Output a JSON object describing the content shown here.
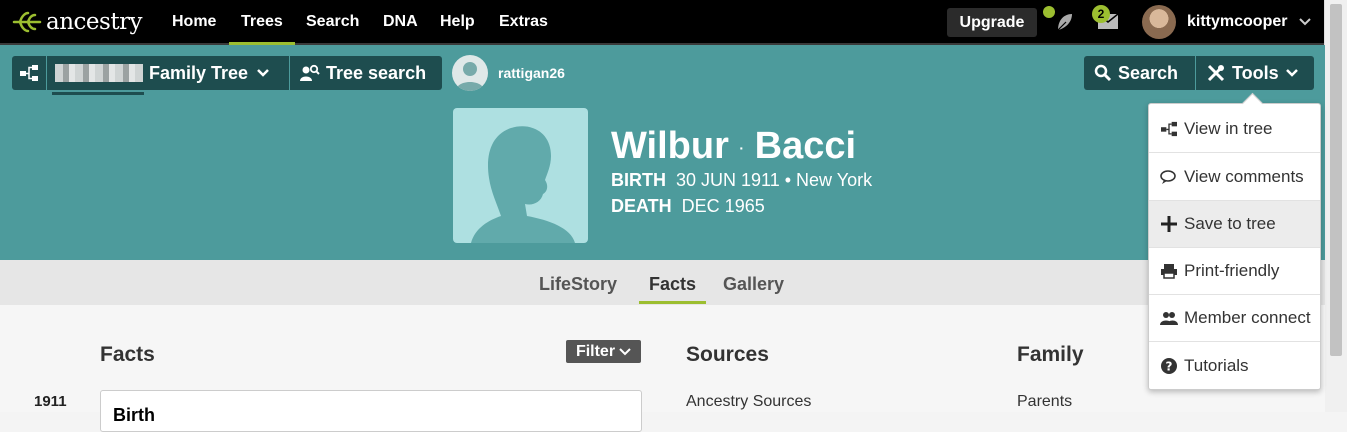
{
  "topnav": {
    "brand": "ancestry",
    "links": [
      "Home",
      "Trees",
      "Search",
      "DNA",
      "Help",
      "Extras"
    ],
    "active_link": "Trees",
    "upgrade_label": "Upgrade",
    "messages_count": "2",
    "username": "kittymcooper",
    "icons": [
      "leaf-icon",
      "mail-icon",
      "avatar",
      "chevron-down-icon"
    ]
  },
  "treebar": {
    "family_tree_label": "Family Tree",
    "tree_search_label": "Tree search",
    "owner": "rattigan26",
    "search_label": "Search",
    "tools_label": "Tools"
  },
  "person": {
    "first_name": "Wilbur",
    "last_name": "Bacci",
    "birth_label": "BIRTH",
    "birth_value": "30 JUN 1911 • New York",
    "death_label": "DEATH",
    "death_value": "DEC 1965"
  },
  "tabs": [
    {
      "label": "LifeStory",
      "active": false
    },
    {
      "label": "Facts",
      "active": true
    },
    {
      "label": "Gallery",
      "active": false
    }
  ],
  "content": {
    "facts_heading": "Facts",
    "filter_label": "Filter",
    "first_year": "1911",
    "first_fact": "Birth",
    "sources_heading": "Sources",
    "sources_first": "Ancestry Sources",
    "family_heading": "Family",
    "family_first": "Parents"
  },
  "tools_menu": {
    "items": [
      {
        "label": "View in tree",
        "icon": "tree-icon"
      },
      {
        "label": "View comments",
        "icon": "comments-icon"
      },
      {
        "label": "Save to tree",
        "icon": "plus-icon",
        "highlighted": true
      },
      {
        "label": "Print-friendly",
        "icon": "printer-icon"
      },
      {
        "label": "Member connect",
        "icon": "members-icon"
      },
      {
        "label": "Tutorials",
        "icon": "question-icon"
      }
    ]
  },
  "colors": {
    "header_teal": "#4d9b9c",
    "dark_button": "#1e4d4f",
    "accent_green": "#9cbe30",
    "portrait_bg": "#aee0e1"
  }
}
